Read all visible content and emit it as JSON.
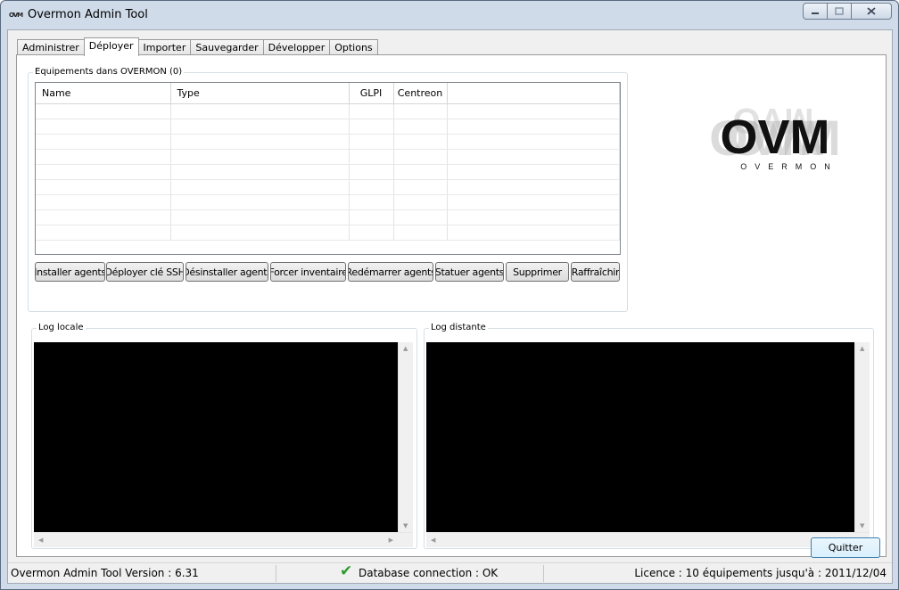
{
  "window": {
    "title": "Overmon Admin Tool",
    "app_icon_text": "OVM"
  },
  "tabs": [
    "Administrer",
    "Déployer",
    "Importer",
    "Sauvegarder",
    "Développer",
    "Options"
  ],
  "active_tab": "Déployer",
  "equipment_group": {
    "title": "Equipements dans OVERMON (0)",
    "columns": [
      "Name",
      "Type",
      "GLPI",
      "Centreon"
    ]
  },
  "buttons": {
    "install_agents": "Installer agents",
    "deploy_ssh_key": "Déployer clé SSH",
    "uninstall_agents": "Désinstaller agents",
    "force_inventory": "Forcer inventaire",
    "restart_agents": "Redémarrer agents",
    "status_agents": "Statuer agents",
    "delete": "Supprimer",
    "refresh": "Raffraîchir",
    "quit": "Quitter"
  },
  "logo": {
    "text": "OVM",
    "subtitle": "OVERMON"
  },
  "logs": {
    "local_title": "Log locale",
    "remote_title": "Log distante"
  },
  "status": {
    "version": "Overmon Admin Tool Version : 6.31",
    "db": "Database connection : OK",
    "license": "Licence : 10 équipements jusqu'à : 2011/12/04",
    "db_ok_color": "#2d9a2d"
  }
}
